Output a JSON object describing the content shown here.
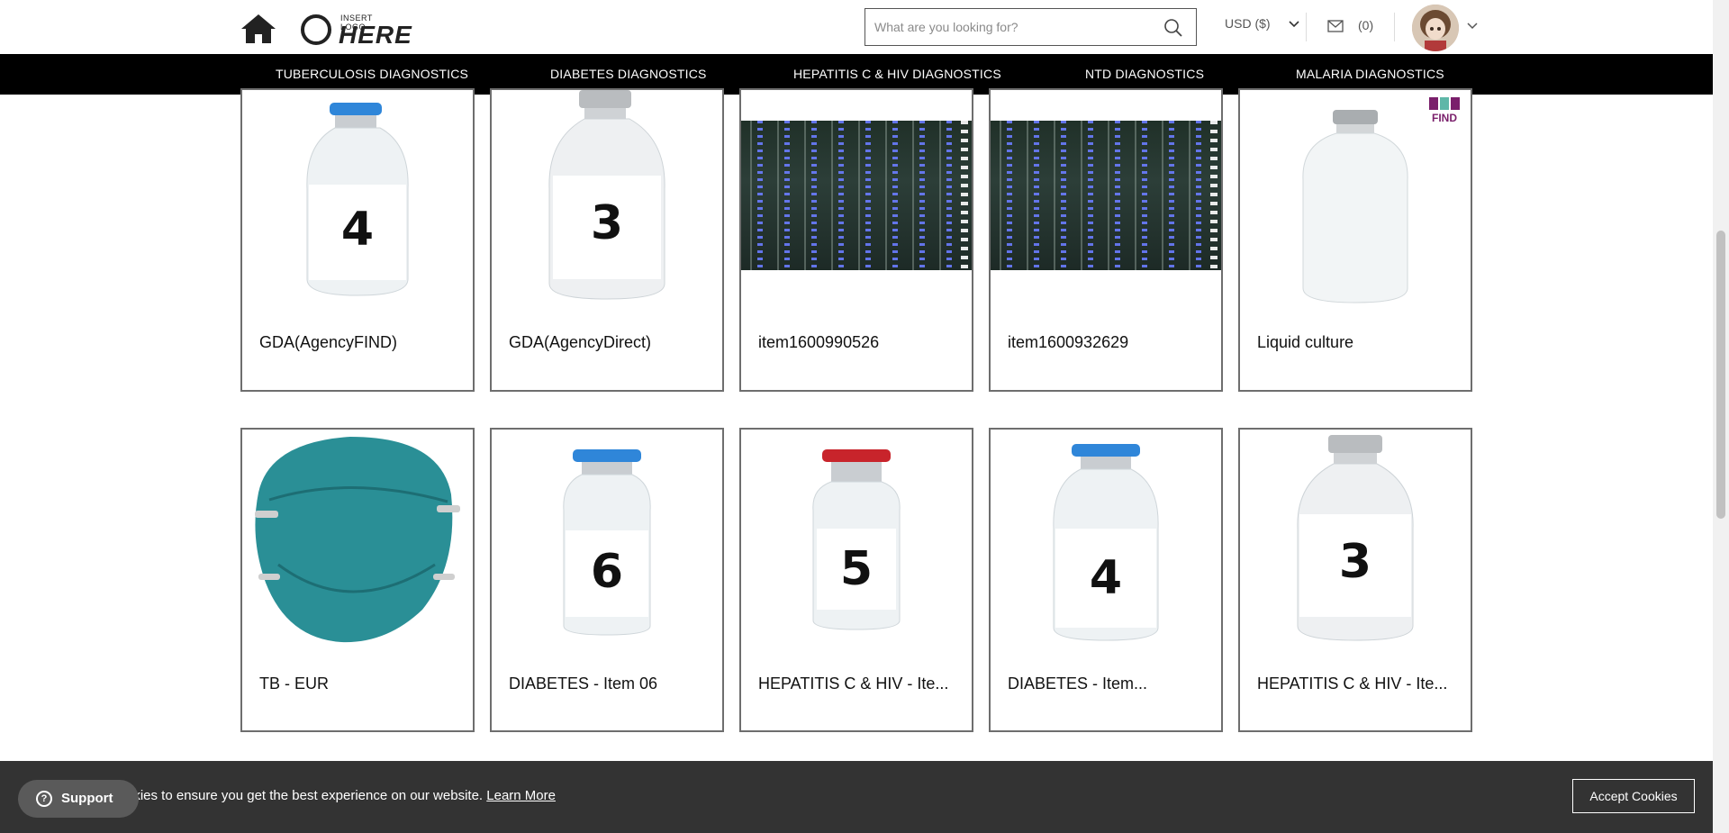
{
  "header": {
    "logo_small": "INSERT LOGO",
    "logo_big": "HERE",
    "search_placeholder": "What are you looking for?",
    "currency": "USD ($)",
    "mail_count": "(0)"
  },
  "nav": {
    "items": [
      "TUBERCULOSIS DIAGNOSTICS",
      "DIABETES DIAGNOSTICS",
      "HEPATITIS C & HIV DIAGNOSTICS",
      "NTD DIAGNOSTICS",
      "MALARIA DIAGNOSTICS"
    ]
  },
  "products": {
    "row1": [
      {
        "title": "GDA(AgencyFIND)",
        "image": "vial-blue-cap",
        "label": "4"
      },
      {
        "title": "GDA(AgencyDirect)",
        "image": "vial-silver-cap",
        "label": "3"
      },
      {
        "title": "item1600990526",
        "image": "server-rack"
      },
      {
        "title": "item1600932629",
        "image": "server-rack"
      },
      {
        "title": "Liquid culture",
        "image": "vial-clear",
        "badge": "FIND"
      }
    ],
    "row2": [
      {
        "title": "TB - EUR",
        "image": "n95-mask"
      },
      {
        "title": "DIABETES - Item 06",
        "image": "vial-blue-cap",
        "label": "6"
      },
      {
        "title": "HEPATITIS C & HIV - Ite...",
        "image": "vial-red-cap",
        "label": "5"
      },
      {
        "title": "DIABETES - Item...",
        "image": "vial-blue-cap",
        "label": "4"
      },
      {
        "title": "HEPATITIS C & HIV - Ite...",
        "image": "vial-silver-cap",
        "label": "3"
      }
    ]
  },
  "cookie": {
    "message": "okies to ensure you get the best experience on our website.",
    "learn_more": "Learn More",
    "accept": "Accept Cookies"
  },
  "support": {
    "label": "Support"
  },
  "colors": {
    "nav_bg": "#000000",
    "cookie_bg": "#333333",
    "card_border": "#6e6e6e",
    "cap_blue": "#2f86d9",
    "cap_red": "#c8242b",
    "find_badge": "#7a1f6b"
  }
}
